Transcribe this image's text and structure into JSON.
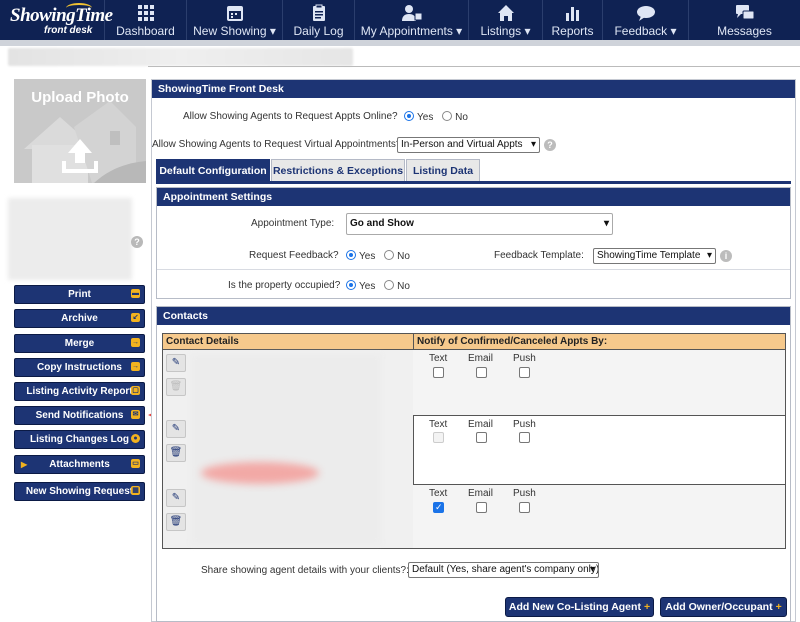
{
  "brand": {
    "line1": "ShowingTime",
    "line2": "front desk"
  },
  "nav": [
    {
      "label": "Dashboard",
      "icon": "grid-icon"
    },
    {
      "label": "New Showing ▾",
      "icon": "calendar-icon"
    },
    {
      "label": "Daily Log",
      "icon": "clipboard-icon"
    },
    {
      "label": "My Appointments ▾",
      "icon": "person-calendar-icon"
    },
    {
      "label": "Listings ▾",
      "icon": "home-icon"
    },
    {
      "label": "Reports",
      "icon": "bar-chart-icon"
    },
    {
      "label": "Feedback ▾",
      "icon": "speech-bubble-icon"
    },
    {
      "label": "Messages",
      "icon": "messages-icon"
    }
  ],
  "sidebar": {
    "upload_photo": "Upload Photo",
    "buttons": [
      "Print",
      "Archive",
      "Merge",
      "Copy Instructions",
      "Listing Activity Report",
      "Send Notifications",
      "Listing Changes Log",
      "Attachments",
      "New Showing Request"
    ]
  },
  "panel": {
    "title": "ShowingTime Front Desk",
    "allow_online_label": "Allow Showing Agents to Request Appts Online?",
    "allow_virtual_label": "Allow Showing Agents to Request Virtual Appointments?",
    "virtual_value": "In-Person and Virtual Appts",
    "yes": "Yes",
    "no": "No",
    "tabs": [
      "Default Configuration",
      "Restrictions & Exceptions",
      "Listing Data"
    ],
    "appointment_settings": {
      "title": "Appointment Settings",
      "type_label": "Appointment Type:",
      "type_value": "Go and Show",
      "feedback_label": "Request Feedback?",
      "template_label": "Feedback Template:",
      "template_value": "ShowingTime Template",
      "occupied_label": "Is the property occupied?"
    },
    "contacts": {
      "title": "Contacts",
      "col_details": "Contact Details",
      "col_notify": "Notify of Confirmed/Canceled Appts By:",
      "channels": [
        "Text",
        "Email",
        "Push"
      ],
      "share_label": "Share showing agent details with your clients?:",
      "share_value": "Default (Yes, share agent's company only)",
      "add_colisting": "Add New Co-Listing Agent",
      "add_owner": "Add Owner/Occupant"
    }
  }
}
